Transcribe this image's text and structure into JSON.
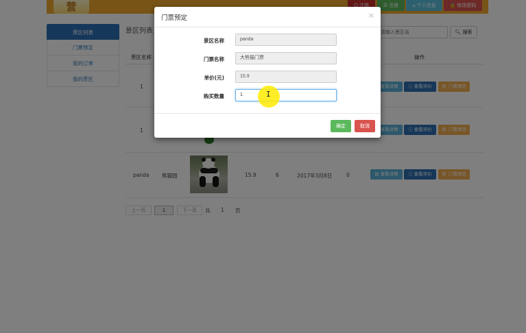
{
  "header": {
    "logo_text": "营",
    "buttons": [
      {
        "label": "注销",
        "icon": "power-icon",
        "color": "#c9302c"
      },
      {
        "label": "注册",
        "icon": "list-icon",
        "color": "#5cb85c"
      },
      {
        "label": "个人信息",
        "icon": "home-icon",
        "color": "#5bc0de"
      },
      {
        "label": "修改密码",
        "icon": "lock-icon",
        "color": "#d9534f"
      }
    ]
  },
  "sidebar": {
    "items": [
      {
        "label": "景区列表",
        "active": true
      },
      {
        "label": "门票预定",
        "active": false
      },
      {
        "label": "我的订单",
        "active": false
      },
      {
        "label": "我的景区",
        "active": false
      }
    ]
  },
  "content": {
    "panel_title": "景区列表",
    "search_placeholder": "请输入景区名",
    "search_button": "搜索",
    "table_headers": {
      "name": "景区名称",
      "actions": "操作"
    },
    "rows": [
      {
        "name": "1"
      },
      {
        "name": "1"
      },
      {
        "name": "panda",
        "ticket": "熊猫园",
        "price": "15.9",
        "count": "6",
        "date": "2017年3月8日",
        "sold": "0"
      }
    ],
    "action_labels": {
      "detail": "查看详情",
      "review": "查看评价",
      "book": "门票预定"
    },
    "pagination": {
      "prev": "上一页",
      "current": "1",
      "next": "下一页",
      "total_prefix": "共",
      "total": "1",
      "total_suffix": "页"
    }
  },
  "modal": {
    "title": "门票预定",
    "close": "×",
    "fields": [
      {
        "label": "景区名称",
        "value": "panda"
      },
      {
        "label": "门票名称",
        "value": "大熊猫门票"
      },
      {
        "label": "单价(元)",
        "value": "15.9"
      },
      {
        "label": "购买数量",
        "value": "1"
      }
    ],
    "confirm_label": "确定",
    "cancel_label": "取消"
  },
  "colors": {
    "header": "#f0a92e",
    "primary": "#2a6fb5",
    "success": "#5cb85c",
    "danger": "#d9534f",
    "info": "#5bb0d6",
    "warning": "#f0ad4e"
  }
}
